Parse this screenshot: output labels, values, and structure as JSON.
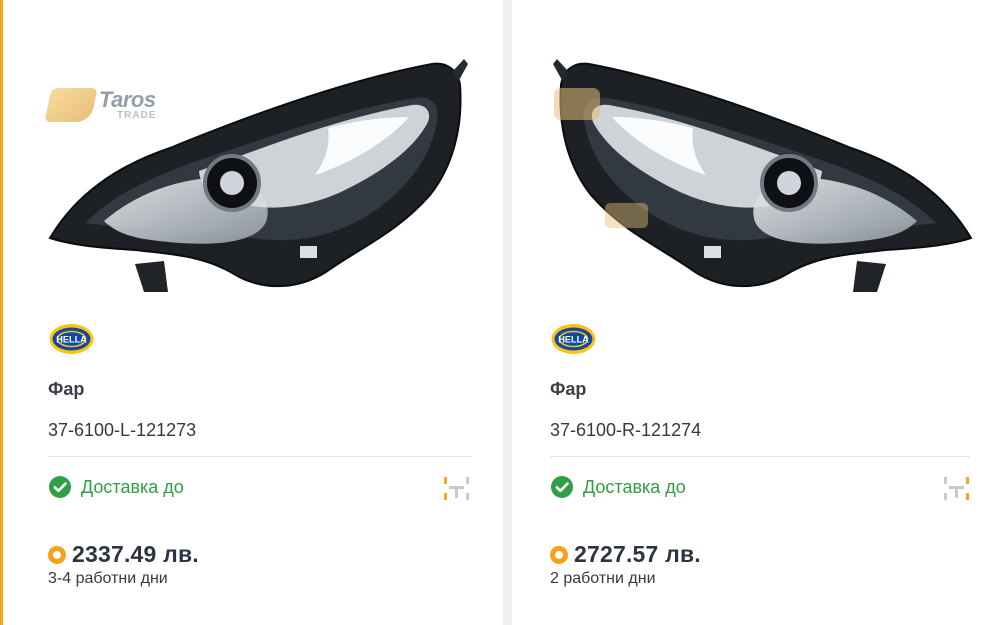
{
  "cards": [
    {
      "image_alt": "Фар",
      "watermark": {
        "main": "Taros",
        "sub": "TRADE"
      },
      "brand": "HELLA",
      "title": "Фар",
      "code": "37-6100-L-121273",
      "delivery_label": "Доставка до",
      "price": "2337.49 лв.",
      "delivery_time": "3-4 работни дни"
    },
    {
      "image_alt": "Фар",
      "brand": "HELLA",
      "title": "Фар",
      "code": "37-6100-R-121274",
      "delivery_label": "Доставка до",
      "price": "2727.57 лв.",
      "delivery_time": "2 работни дни"
    }
  ],
  "colors": {
    "accent": "#f2a81d",
    "success": "#2ea043",
    "price": "#2d3340"
  }
}
